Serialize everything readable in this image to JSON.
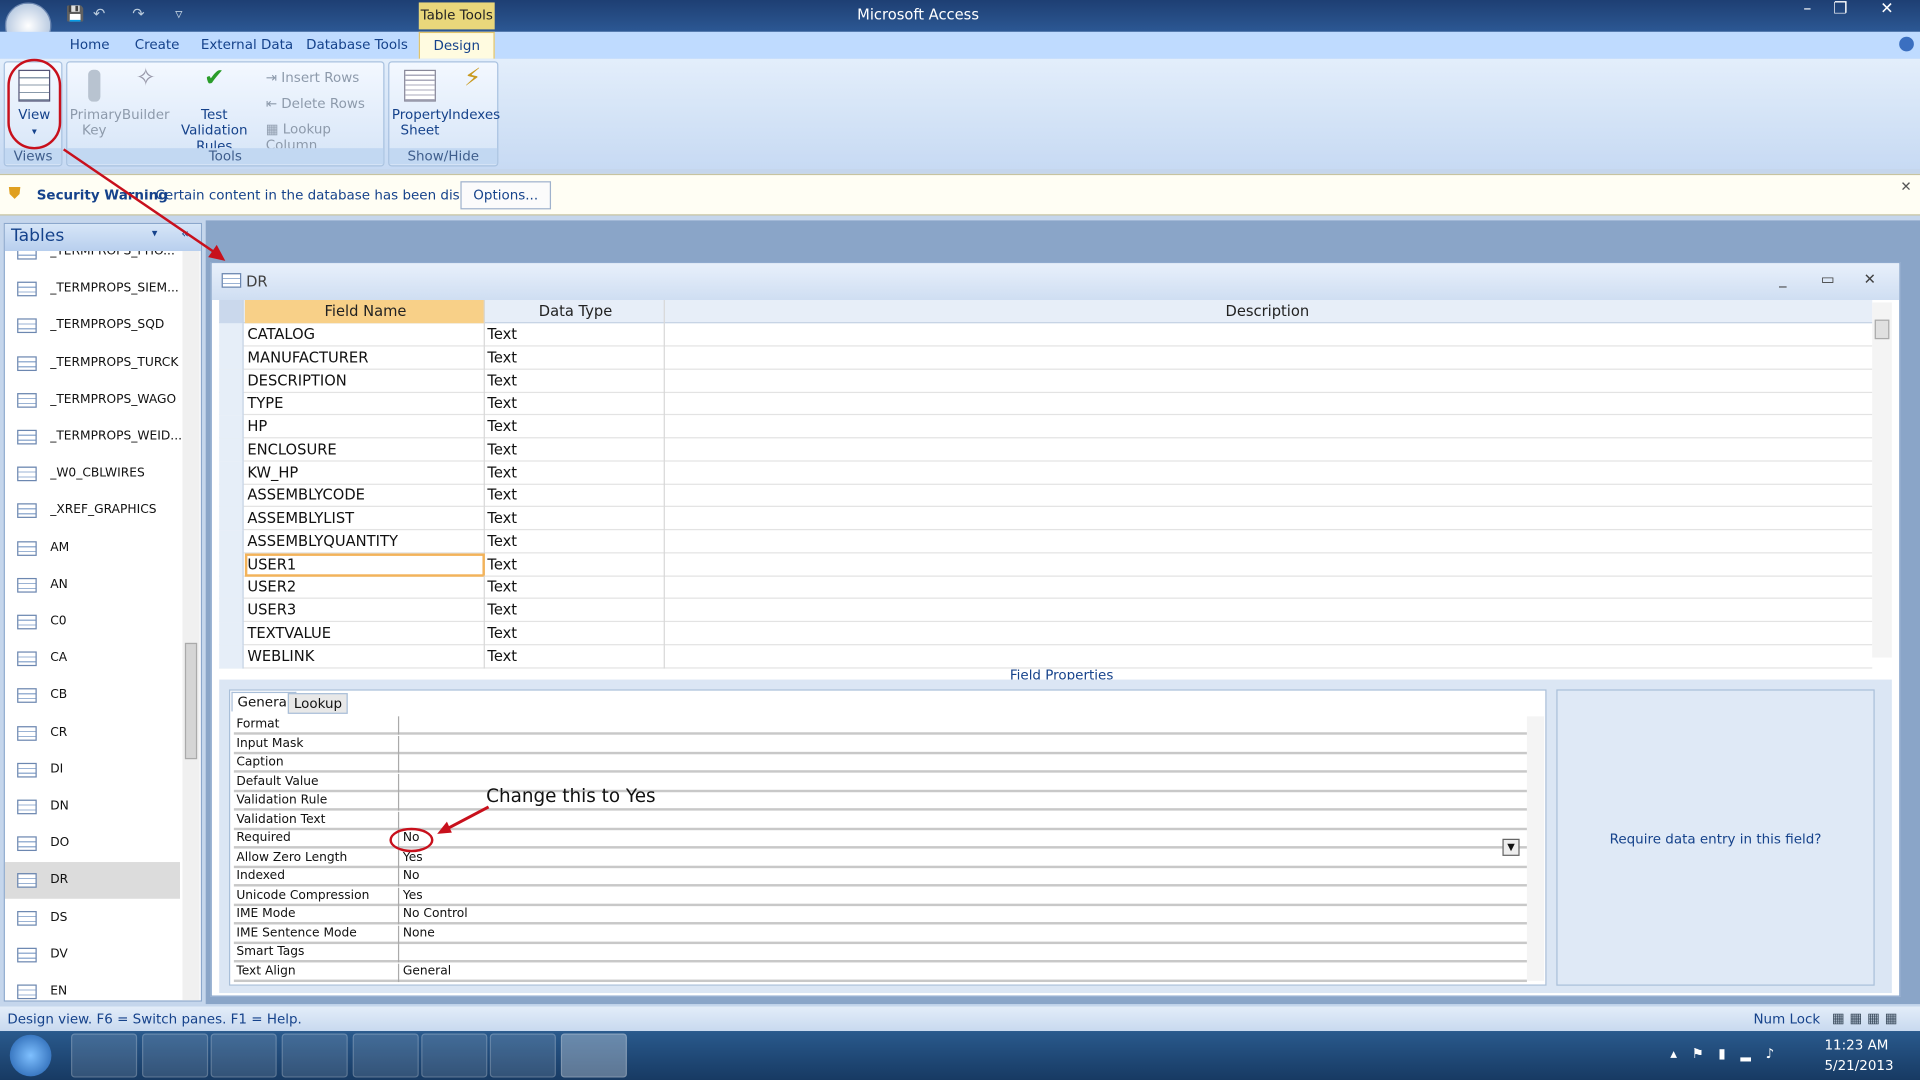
{
  "window": {
    "title": "Microsoft Access",
    "context_tab": "Table Tools"
  },
  "ribbon": {
    "tabs": [
      "Home",
      "Create",
      "External Data",
      "Database Tools",
      "Design"
    ],
    "active_tab": "Design",
    "groups": {
      "views": "Views",
      "tools": "Tools",
      "showhide": "Show/Hide"
    },
    "buttons": {
      "view": "View",
      "primary_key": [
        "Primary",
        "Key"
      ],
      "builder": "Builder",
      "test_validation": [
        "Test Validation",
        "Rules"
      ],
      "insert_rows": "Insert Rows",
      "delete_rows": "Delete Rows",
      "lookup_column": "Lookup Column",
      "property_sheet": [
        "Property",
        "Sheet"
      ],
      "indexes": "Indexes"
    }
  },
  "security": {
    "title": "Security Warning",
    "message": "Certain content in the database has been disabled",
    "options": "Options..."
  },
  "nav": {
    "header": "Tables",
    "items": [
      "_TERMPROPS_PHO...",
      "_TERMPROPS_SIEM...",
      "_TERMPROPS_SQD",
      "_TERMPROPS_TURCK",
      "_TERMPROPS_WAGO",
      "_TERMPROPS_WEID...",
      "_W0_CBLWIRES",
      "_XREF_GRAPHICS",
      "AM",
      "AN",
      "C0",
      "CA",
      "CB",
      "CR",
      "DI",
      "DN",
      "DO",
      "DR",
      "DS",
      "DV",
      "EN"
    ],
    "selected": "DR"
  },
  "table": {
    "name": "DR",
    "columns": [
      "Field Name",
      "Data Type",
      "Description"
    ],
    "rows": [
      [
        "CATALOG",
        "Text"
      ],
      [
        "MANUFACTURER",
        "Text"
      ],
      [
        "DESCRIPTION",
        "Text"
      ],
      [
        "TYPE",
        "Text"
      ],
      [
        "HP",
        "Text"
      ],
      [
        "ENCLOSURE",
        "Text"
      ],
      [
        "KW_HP",
        "Text"
      ],
      [
        "ASSEMBLYCODE",
        "Text"
      ],
      [
        "ASSEMBLYLIST",
        "Text"
      ],
      [
        "ASSEMBLYQUANTITY",
        "Text"
      ],
      [
        "USER1",
        "Text"
      ],
      [
        "USER2",
        "Text"
      ],
      [
        "USER3",
        "Text"
      ],
      [
        "TEXTVALUE",
        "Text"
      ],
      [
        "WEBLINK",
        "Text"
      ]
    ],
    "selected_row": "USER1"
  },
  "field_properties": {
    "title": "Field Properties",
    "tabs": [
      "General",
      "Lookup"
    ],
    "rows": [
      [
        "Format",
        ""
      ],
      [
        "Input Mask",
        ""
      ],
      [
        "Caption",
        ""
      ],
      [
        "Default Value",
        ""
      ],
      [
        "Validation Rule",
        ""
      ],
      [
        "Validation Text",
        ""
      ],
      [
        "Required",
        "No"
      ],
      [
        "Allow Zero Length",
        "Yes"
      ],
      [
        "Indexed",
        "No"
      ],
      [
        "Unicode Compression",
        "Yes"
      ],
      [
        "IME Mode",
        "No Control"
      ],
      [
        "IME Sentence Mode",
        "None"
      ],
      [
        "Smart Tags",
        ""
      ],
      [
        "Text Align",
        "General"
      ]
    ],
    "help": "Require data entry in this field?"
  },
  "annotation": "Change this to Yes",
  "annotation_color": "#d0101a",
  "status": {
    "left": "Design view.  F6 = Switch panes.  F1 = Help.",
    "right": "Num Lock"
  },
  "taskbar": {
    "time": "11:23 AM",
    "date": "5/21/2013"
  }
}
